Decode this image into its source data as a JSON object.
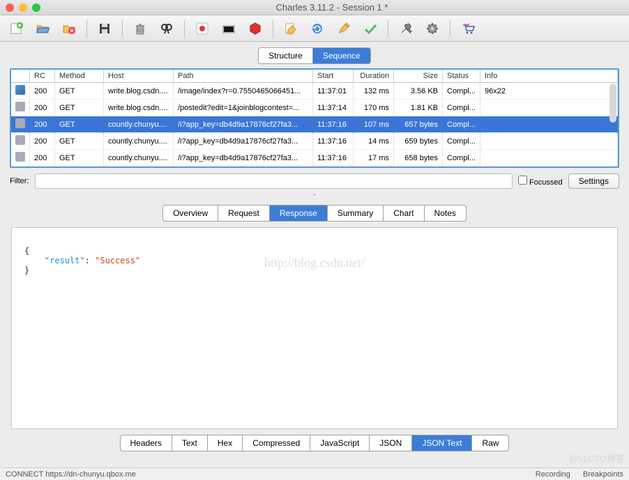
{
  "window": {
    "title": "Charles 3.11.2 - Session 1 *"
  },
  "top_tabs": {
    "structure": "Structure",
    "sequence": "Sequence",
    "active": "sequence"
  },
  "columns": {
    "rc": "RC",
    "method": "Method",
    "host": "Host",
    "path": "Path",
    "start": "Start",
    "duration": "Duration",
    "size": "Size",
    "status": "Status",
    "info": "Info"
  },
  "rows": [
    {
      "icon": "img",
      "rc": "200",
      "method": "GET",
      "host": "write.blog.csdn....",
      "path": "/image/index?r=0.7550465066451...",
      "start": "11:37:01",
      "duration": "132 ms",
      "size": "3.56 KB",
      "status": "Compl...",
      "info": "96x22",
      "selected": false
    },
    {
      "icon": "doc",
      "rc": "200",
      "method": "GET",
      "host": "write.blog.csdn....",
      "path": "/postedit?edit=1&joinblogcontest=...",
      "start": "11:37:14",
      "duration": "170 ms",
      "size": "1.81 KB",
      "status": "Compl...",
      "info": "",
      "selected": false
    },
    {
      "icon": "doc",
      "rc": "200",
      "method": "GET",
      "host": "countly.chunyu....",
      "path": "/i?app_key=db4d9a17876cf27fa3...",
      "start": "11:37:16",
      "duration": "107 ms",
      "size": "657 bytes",
      "status": "Compl...",
      "info": "",
      "selected": true
    },
    {
      "icon": "doc",
      "rc": "200",
      "method": "GET",
      "host": "countly.chunyu....",
      "path": "/i?app_key=db4d9a17876cf27fa3...",
      "start": "11:37:16",
      "duration": "14 ms",
      "size": "659 bytes",
      "status": "Compl...",
      "info": "",
      "selected": false
    },
    {
      "icon": "doc",
      "rc": "200",
      "method": "GET",
      "host": "countly.chunyu....",
      "path": "/i?app_key=db4d9a17876cf27fa3...",
      "start": "11:37:16",
      "duration": "17 ms",
      "size": "658 bytes",
      "status": "Compl...",
      "info": "",
      "selected": false
    }
  ],
  "filter": {
    "label": "Filter:",
    "value": "",
    "focussed_label": "Focussed",
    "settings_label": "Settings"
  },
  "mid_tabs": {
    "items": [
      "Overview",
      "Request",
      "Response",
      "Summary",
      "Chart",
      "Notes"
    ],
    "active": "Response"
  },
  "response": {
    "body_open": "{",
    "key": "\"result\"",
    "colon": ": ",
    "value": "\"Success\"",
    "body_close": "}"
  },
  "watermark": "http://blog.csdn.net/",
  "bottom_tabs": {
    "items": [
      "Headers",
      "Text",
      "Hex",
      "Compressed",
      "JavaScript",
      "JSON",
      "JSON Text",
      "Raw"
    ],
    "active": "JSON Text"
  },
  "statusbar": {
    "left": "CONNECT https://dn-chunyu.qbox.me",
    "recording": "Recording",
    "breakpoints": "Breakpoints"
  },
  "corner_wm": "@51CTO博客",
  "toolbar_icons": [
    "new-session-icon",
    "open-icon",
    "close-icon",
    "save-icon",
    "trash-icon",
    "find-icon",
    "record-icon",
    "throttle-icon",
    "stop-icon",
    "edit-icon",
    "refresh-icon",
    "pencil-icon",
    "check-icon",
    "tools-icon",
    "settings-gear-icon",
    "cart-icon"
  ]
}
